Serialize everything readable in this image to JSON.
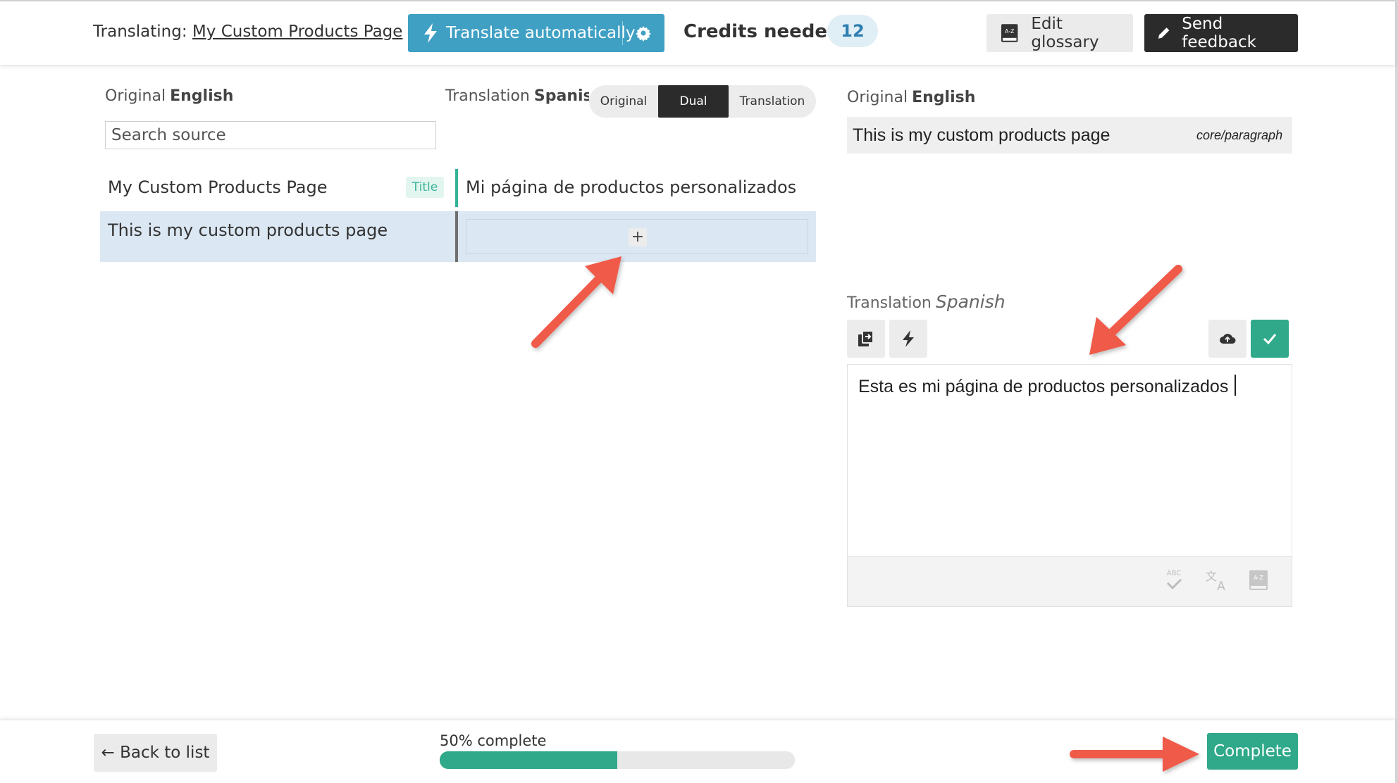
{
  "header": {
    "translating_label": "Translating:",
    "page_link": "My Custom Products Page",
    "translate_button": "Translate automatically",
    "credits_label": "Credits needed",
    "credits_count": "12",
    "glossary_button": "Edit glossary",
    "feedback_button": "Send feedback"
  },
  "left": {
    "original_label": "Original",
    "original_lang": "English",
    "translation_label": "Translation",
    "translation_lang": "Spanish",
    "search_placeholder": "Search source",
    "view_toggle": [
      "Original",
      "Dual",
      "Translation"
    ],
    "view_selected": "Dual",
    "rows": [
      {
        "source": "My Custom Products Page",
        "badge": "Title",
        "translation": "Mi página de productos personalizados"
      },
      {
        "source": "This is my custom products page",
        "add_label": "+"
      }
    ]
  },
  "right": {
    "original_label": "Original",
    "original_lang": "English",
    "original_text": "This is my custom products page",
    "block_type": "core/paragraph",
    "translation_label": "Translation",
    "translation_lang": "Spanish",
    "editor_text": "Esta es mi página de productos personalizados"
  },
  "footer": {
    "back_button": "← Back to list",
    "progress_label": "50% complete",
    "progress": 0.5,
    "complete_button": "Complete"
  },
  "colors": {
    "accent_blue": "#3fa0c4",
    "accent_green": "#2fa98a",
    "arrow_red": "#f05a4a",
    "dark": "#2b2b2b"
  }
}
